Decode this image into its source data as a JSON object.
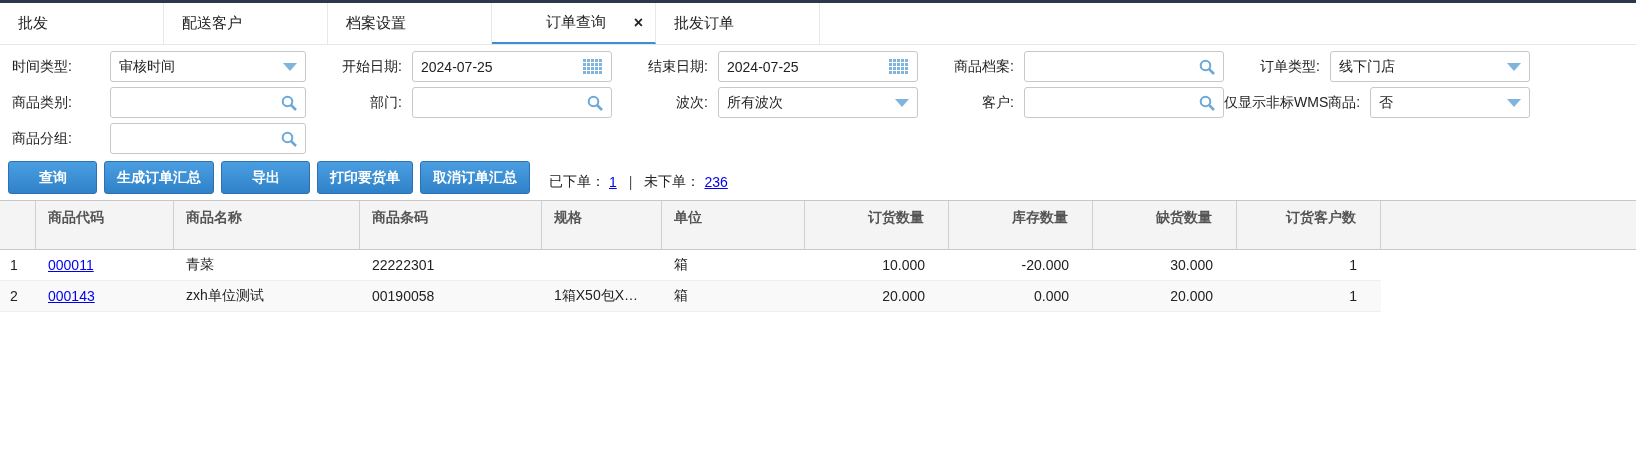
{
  "tabs": [
    {
      "label": "批发",
      "selected": false
    },
    {
      "label": "配送客户",
      "selected": false
    },
    {
      "label": "档案设置",
      "selected": false
    },
    {
      "label": "订单查询",
      "selected": true,
      "close": "×"
    },
    {
      "label": "批发订单",
      "selected": false
    }
  ],
  "filters": [
    [
      {
        "label": "时间类型:",
        "kind": "select",
        "value": "审核时间"
      },
      {
        "label": "开始日期:",
        "kind": "date",
        "value": "2024-07-25"
      },
      {
        "label": "结束日期:",
        "kind": "date",
        "value": "2024-07-25"
      },
      {
        "label": "商品档案:",
        "kind": "search"
      },
      {
        "label": "订单类型:",
        "kind": "select",
        "value": "线下门店"
      }
    ],
    [
      {
        "label": "商品类别:",
        "kind": "search"
      },
      {
        "label": "部门:",
        "kind": "search"
      },
      {
        "label": "波次:",
        "kind": "select",
        "value": "所有波次"
      },
      {
        "label": "客户:",
        "kind": "search"
      },
      {
        "label": "仅显示非标WMS商品:",
        "kind": "select",
        "value": "否"
      }
    ],
    [
      {
        "label": "商品分组:",
        "kind": "search"
      }
    ]
  ],
  "buttons": [
    "查询",
    "生成订单汇总",
    "导出",
    "打印要货单",
    "取消订单汇总"
  ],
  "summary": {
    "ordered_label": "已下单：",
    "ordered": "1",
    "separator": "|",
    "not_ordered_label": "未下单：",
    "not_ordered": "236"
  },
  "table": {
    "columns": [
      "商品代码",
      "商品名称",
      "商品条码",
      "规格",
      "单位",
      "订货数量",
      "库存数量",
      "缺货数量",
      "订货客户数"
    ],
    "rows": [
      {
        "index": "1",
        "cells": [
          "000011",
          "青菜",
          "22222301",
          "",
          "箱",
          "10.000",
          "-20.000",
          "30.000",
          "1"
        ]
      },
      {
        "index": "2",
        "cells": [
          "000143",
          "zxh单位测试",
          "00190058",
          "1箱X50包X…",
          "箱",
          "20.000",
          "0.000",
          "20.000",
          "1"
        ]
      }
    ]
  }
}
